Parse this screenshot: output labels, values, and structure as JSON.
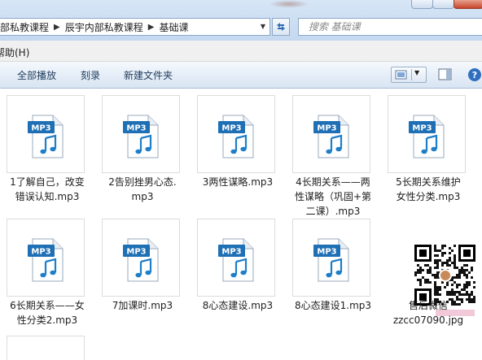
{
  "window": {
    "address_crumbs": [
      "部私教课程",
      "辰宇内部私教课程",
      "基础课"
    ],
    "search_placeholder": "搜索 基础课"
  },
  "menu": {
    "help_label": "帮助(H)"
  },
  "toolbar": {
    "play_all": "全部播放",
    "burn": "刻录",
    "new_folder": "新建文件夹"
  },
  "files": [
    {
      "name": "1了解自己，改变错误认知.mp3",
      "lines": [
        "1了解自己，改变",
        "错误认知.mp3"
      ],
      "type": "mp3"
    },
    {
      "name": "2告别挫男心态.mp3",
      "lines": [
        "2告别挫男心态.",
        "mp3"
      ],
      "type": "mp3"
    },
    {
      "name": "3两性谋略.mp3",
      "lines": [
        "3两性谋略.mp3"
      ],
      "type": "mp3"
    },
    {
      "name": "4长期关系——两性谋略（巩固+第二课）.mp3",
      "lines": [
        "4长期关系——两",
        "性谋略（巩固+第",
        "二课）.mp3"
      ],
      "type": "mp3"
    },
    {
      "name": "5长期关系维护女性分类.mp3",
      "lines": [
        "5长期关系维护",
        "女性分类.mp3"
      ],
      "type": "mp3"
    },
    {
      "name": "6长期关系——女性分类2.mp3",
      "lines": [
        "6长期关系——女",
        "性分类2.mp3"
      ],
      "type": "mp3"
    },
    {
      "name": "7加课时.mp3",
      "lines": [
        "7加课时.mp3"
      ],
      "type": "mp3"
    },
    {
      "name": "8心态建设.mp3",
      "lines": [
        "8心态建设.mp3"
      ],
      "type": "mp3"
    },
    {
      "name": "8心态建设1.mp3",
      "lines": [
        "8心态建设1.mp3"
      ],
      "type": "mp3"
    },
    {
      "name": "售后微信zzcc07090.jpg",
      "lines": [
        "售后微信",
        "zzcc07090.jpg"
      ],
      "type": "jpg"
    }
  ],
  "icons": {
    "mp3_badge": "MP3",
    "mp3_color": "#1e7ec8",
    "mp3_badge_bg": "#1f6fb5"
  }
}
